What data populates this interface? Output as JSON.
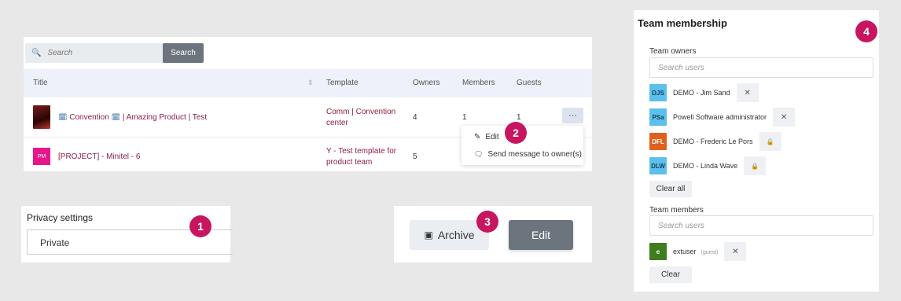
{
  "table": {
    "search_placeholder": "Search",
    "search_button": "Search",
    "headers": {
      "title": "Title",
      "template": "Template",
      "owners": "Owners",
      "members": "Members",
      "guests": "Guests"
    },
    "rows": [
      {
        "title": "Convention",
        "title_rest": "| Amazing Product | Test",
        "template_line1": "Comm | Convention",
        "template_line2": "center",
        "owners": "4",
        "members": "1",
        "guests": "1"
      },
      {
        "badge": "PM",
        "title": "[PROJECT] - Minitel - 6",
        "template_line1": "Y - Test template for",
        "template_line2": "product team",
        "owners": "5"
      }
    ],
    "more_label": "···",
    "menu": {
      "edit": "Edit",
      "message": "Send message to owner(s)"
    }
  },
  "badges": [
    "1",
    "2",
    "3",
    "4"
  ],
  "privacy": {
    "title": "Privacy settings",
    "value": "Private"
  },
  "actions": {
    "archive": "Archive",
    "edit": "Edit"
  },
  "team": {
    "title": "Team membership",
    "owners_label": "Team owners",
    "owners_placeholder": "Search users",
    "owners": [
      {
        "initials": "DJS",
        "name": "DEMO - Jim Sand",
        "action": "✕",
        "color": "#5bc0eb"
      },
      {
        "initials": "PSa",
        "name": "Powell Software administrator",
        "action": "✕",
        "color": "#5bc0eb"
      },
      {
        "initials": "DFL",
        "name": "DEMO - Frederic Le Pors",
        "action": "🔒",
        "color": "#e0601f"
      },
      {
        "initials": "DLW",
        "name": "DEMO - Linda Wave",
        "action": "🔒",
        "color": "#5bc0eb"
      }
    ],
    "clear_all": "Clear all",
    "members_label": "Team members",
    "members_placeholder": "Search users",
    "members": [
      {
        "initials": "e",
        "name": "extuser",
        "tag": "(guest)",
        "action": "✕",
        "color": "#3f7d1d"
      }
    ],
    "clear": "Clear"
  },
  "colors": {
    "accent": "#c8155f",
    "link": "#8b1f40",
    "button": "#6c757d"
  }
}
